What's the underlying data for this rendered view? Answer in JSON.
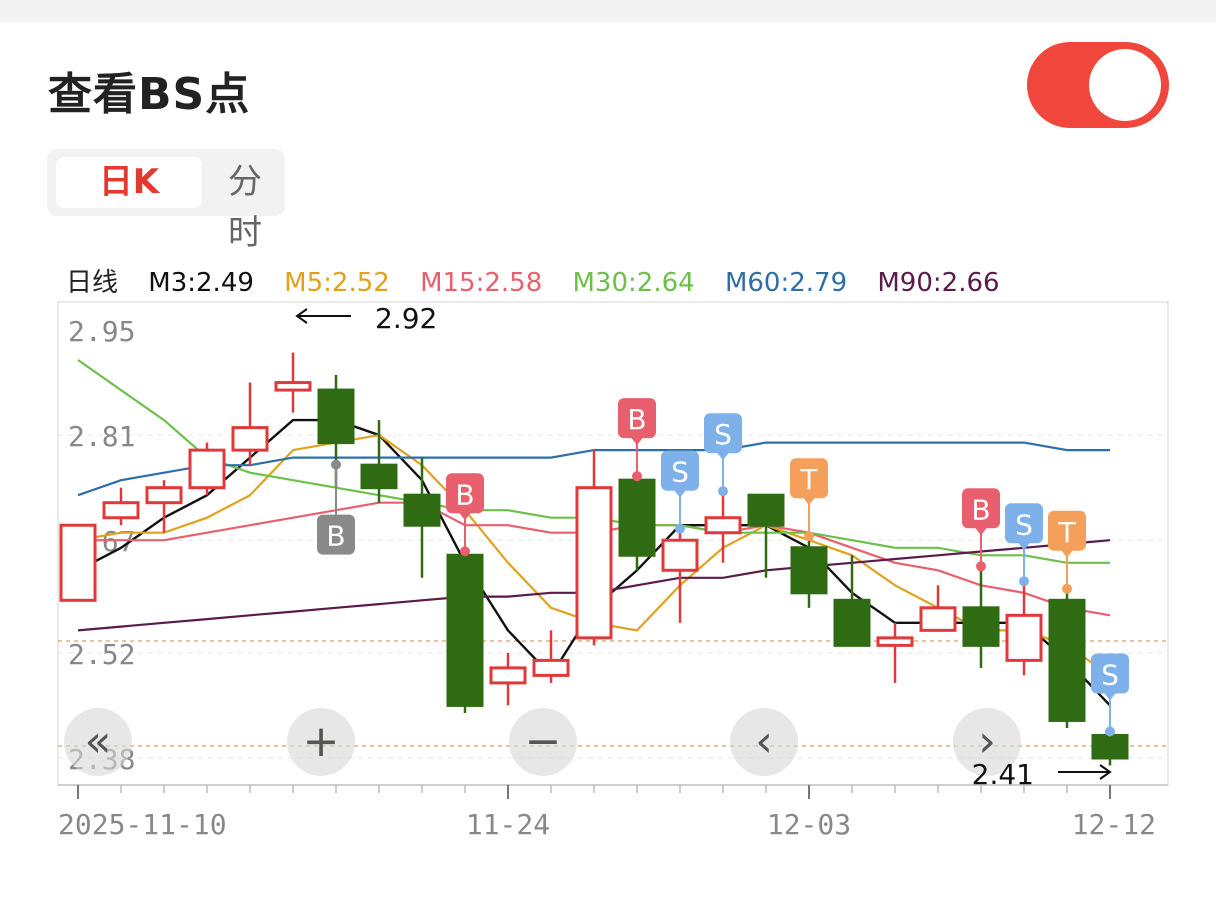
{
  "header": {
    "title": "查看BS点",
    "toggle_on": true
  },
  "tabs": [
    {
      "label": "日K",
      "active": true
    },
    {
      "label": "分时",
      "active": false
    }
  ],
  "legend": {
    "prefix": "日线",
    "items": [
      {
        "label": "M3:2.49",
        "color": "#111111"
      },
      {
        "label": "M5:2.52",
        "color": "#e0a21c"
      },
      {
        "label": "M15:2.58",
        "color": "#e8606e"
      },
      {
        "label": "M30:2.64",
        "color": "#6cc04a"
      },
      {
        "label": "M60:2.79",
        "color": "#2f6fa8"
      },
      {
        "label": "M90:2.66",
        "color": "#5a1a4a"
      }
    ]
  },
  "chart_data": {
    "type": "candlestick",
    "y_ticks": [
      "2.95",
      "2.81",
      "2.67",
      "2.52",
      "2.38"
    ],
    "ylim": [
      2.355,
      2.965
    ],
    "x_labels": [
      {
        "label": "2025-11-10",
        "index": 0
      },
      {
        "label": "11-24",
        "index": 10
      },
      {
        "label": "12-03",
        "index": 17
      },
      {
        "label": "12-12",
        "index": 24
      }
    ],
    "candles": [
      {
        "o": 2.59,
        "c": 2.69,
        "h": 2.69,
        "l": 2.59
      },
      {
        "o": 2.7,
        "c": 2.72,
        "h": 2.74,
        "l": 2.69
      },
      {
        "o": 2.72,
        "c": 2.74,
        "h": 2.75,
        "l": 2.68
      },
      {
        "o": 2.74,
        "c": 2.79,
        "h": 2.8,
        "l": 2.73
      },
      {
        "o": 2.79,
        "c": 2.82,
        "h": 2.88,
        "l": 2.77
      },
      {
        "o": 2.87,
        "c": 2.88,
        "h": 2.92,
        "l": 2.84
      },
      {
        "o": 2.87,
        "c": 2.8,
        "h": 2.89,
        "l": 2.74
      },
      {
        "o": 2.77,
        "c": 2.74,
        "h": 2.83,
        "l": 2.72
      },
      {
        "o": 2.73,
        "c": 2.69,
        "h": 2.78,
        "l": 2.62
      },
      {
        "o": 2.65,
        "c": 2.45,
        "h": 2.65,
        "l": 2.44
      },
      {
        "o": 2.48,
        "c": 2.5,
        "h": 2.52,
        "l": 2.45
      },
      {
        "o": 2.49,
        "c": 2.51,
        "h": 2.55,
        "l": 2.48
      },
      {
        "o": 2.54,
        "c": 2.74,
        "h": 2.79,
        "l": 2.53
      },
      {
        "o": 2.75,
        "c": 2.65,
        "h": 2.75,
        "l": 2.63
      },
      {
        "o": 2.63,
        "c": 2.67,
        "h": 2.68,
        "l": 2.56
      },
      {
        "o": 2.68,
        "c": 2.7,
        "h": 2.73,
        "l": 2.64
      },
      {
        "o": 2.73,
        "c": 2.69,
        "h": 2.73,
        "l": 2.62
      },
      {
        "o": 2.66,
        "c": 2.6,
        "h": 2.67,
        "l": 2.58
      },
      {
        "o": 2.59,
        "c": 2.53,
        "h": 2.65,
        "l": 2.53
      },
      {
        "o": 2.53,
        "c": 2.54,
        "h": 2.56,
        "l": 2.48
      },
      {
        "o": 2.55,
        "c": 2.58,
        "h": 2.61,
        "l": 2.55
      },
      {
        "o": 2.58,
        "c": 2.53,
        "h": 2.63,
        "l": 2.5
      },
      {
        "o": 2.51,
        "c": 2.57,
        "h": 2.61,
        "l": 2.49
      },
      {
        "o": 2.59,
        "c": 2.43,
        "h": 2.6,
        "l": 2.42
      },
      {
        "o": 2.41,
        "c": 2.38,
        "h": 2.41,
        "l": 2.37
      }
    ],
    "ma_series": [
      {
        "name": "M3",
        "color": "#111111",
        "values": [
          2.63,
          2.66,
          2.7,
          2.73,
          2.78,
          2.83,
          2.83,
          2.81,
          2.75,
          2.64,
          2.55,
          2.49,
          2.58,
          2.63,
          2.69,
          2.69,
          2.69,
          2.66,
          2.6,
          2.56,
          2.56,
          2.56,
          2.56,
          2.51,
          2.45
        ]
      },
      {
        "name": "M5",
        "color": "#e0a21c",
        "values": [
          2.67,
          2.68,
          2.68,
          2.7,
          2.73,
          2.79,
          2.8,
          2.81,
          2.77,
          2.71,
          2.64,
          2.58,
          2.56,
          2.55,
          2.61,
          2.66,
          2.69,
          2.67,
          2.65,
          2.61,
          2.58,
          2.55,
          2.55,
          2.53,
          2.49
        ]
      },
      {
        "name": "M15",
        "color": "#e8606e",
        "values": [
          2.67,
          2.67,
          2.67,
          2.68,
          2.69,
          2.7,
          2.71,
          2.72,
          2.72,
          2.69,
          2.69,
          2.68,
          2.68,
          2.69,
          2.69,
          2.68,
          2.69,
          2.68,
          2.66,
          2.64,
          2.63,
          2.61,
          2.6,
          2.58,
          2.57
        ]
      },
      {
        "name": "M30",
        "color": "#6cc04a",
        "values": [
          2.91,
          2.87,
          2.83,
          2.78,
          2.76,
          2.75,
          2.74,
          2.73,
          2.72,
          2.71,
          2.71,
          2.7,
          2.7,
          2.69,
          2.69,
          2.68,
          2.68,
          2.68,
          2.67,
          2.66,
          2.66,
          2.65,
          2.65,
          2.64,
          2.64
        ]
      },
      {
        "name": "M60",
        "color": "#2f6fa8",
        "values": [
          2.73,
          2.75,
          2.76,
          2.77,
          2.77,
          2.78,
          2.78,
          2.78,
          2.78,
          2.78,
          2.78,
          2.78,
          2.79,
          2.79,
          2.79,
          2.79,
          2.8,
          2.8,
          2.8,
          2.8,
          2.8,
          2.8,
          2.8,
          2.79,
          2.79
        ]
      },
      {
        "name": "M90",
        "color": "#5a1a4a",
        "values": [
          2.55,
          2.555,
          2.56,
          2.565,
          2.57,
          2.575,
          2.58,
          2.585,
          2.59,
          2.595,
          2.595,
          2.6,
          2.6,
          2.61,
          2.62,
          2.62,
          2.63,
          2.635,
          2.64,
          2.645,
          2.65,
          2.655,
          2.66,
          2.665,
          2.67
        ]
      }
    ],
    "signals": [
      {
        "label": "B",
        "index": 6,
        "side": "below",
        "color": "#8a8a8a"
      },
      {
        "label": "B",
        "index": 9,
        "side": "above",
        "color": "#e8606e"
      },
      {
        "label": "B",
        "index": 13,
        "side": "above",
        "color": "#e8606e"
      },
      {
        "label": "S",
        "index": 14,
        "side": "above",
        "color": "#7eb1ea"
      },
      {
        "label": "S",
        "index": 15,
        "side": "above",
        "color": "#7eb1ea"
      },
      {
        "label": "T",
        "index": 17,
        "side": "above",
        "color": "#f5a05a"
      },
      {
        "label": "B",
        "index": 21,
        "side": "above",
        "color": "#e8606e"
      },
      {
        "label": "S",
        "index": 22,
        "side": "above",
        "color": "#7eb1ea"
      },
      {
        "label": "T",
        "index": 23,
        "side": "above",
        "color": "#f5a05a"
      },
      {
        "label": "S",
        "index": 24,
        "side": "above",
        "color": "#7eb1ea"
      }
    ],
    "high_marker": {
      "label": "2.92",
      "index": 5,
      "value": 2.92
    },
    "low_marker": {
      "label": "2.41",
      "index": 24,
      "value": 2.38
    },
    "ref_lines": [
      2.5,
      2.38
    ],
    "colors": {
      "up": "#e0393b",
      "down": "#2f6b12"
    }
  },
  "controls": [
    {
      "name": "scroll-start-button",
      "icon": "double-chevron-left-icon",
      "glyph": "«"
    },
    {
      "name": "zoom-in-button",
      "icon": "plus-icon",
      "glyph": "+"
    },
    {
      "name": "zoom-out-button",
      "icon": "minus-icon",
      "glyph": "−"
    },
    {
      "name": "scroll-left-button",
      "icon": "chevron-left-icon",
      "glyph": "‹"
    },
    {
      "name": "scroll-right-button",
      "icon": "chevron-right-icon",
      "glyph": "›"
    }
  ]
}
